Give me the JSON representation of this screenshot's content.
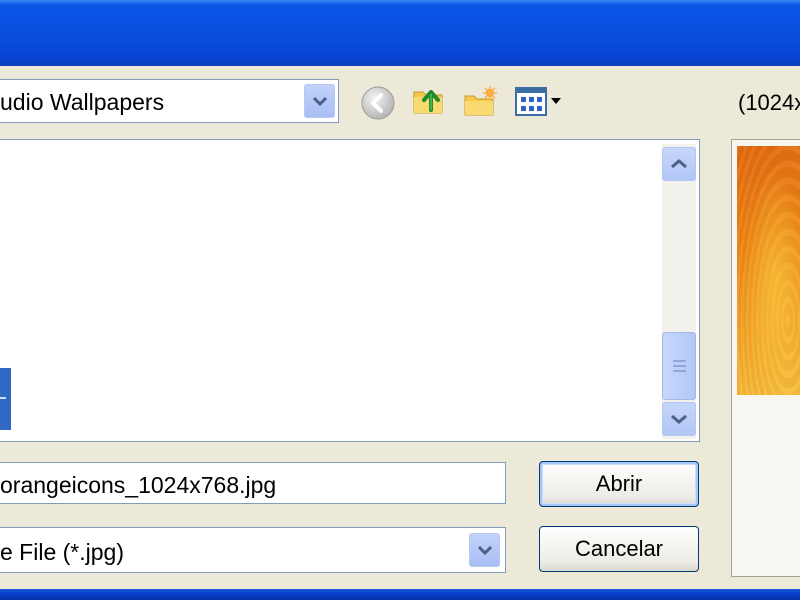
{
  "dialog": {
    "look_in": {
      "value": "udio Wallpapers"
    },
    "toolbar": {
      "back_icon": "back-arrow-icon",
      "up_folder_icon": "up-one-level-icon",
      "new_folder_icon": "new-folder-icon",
      "views_icon": "views-menu-icon"
    },
    "preview": {
      "resolution_label": "(1024x"
    },
    "file_name": {
      "value": "orangeicons_1024x768.jpg"
    },
    "file_type": {
      "value": "e File (*.jpg)"
    },
    "buttons": {
      "open_label": "Abrir",
      "cancel_label": "Cancelar"
    },
    "colors": {
      "title_bar": "#0a4fe0",
      "dialog_face": "#ece9d8",
      "selection": "#316ac5",
      "button_border": "#003c74"
    }
  }
}
